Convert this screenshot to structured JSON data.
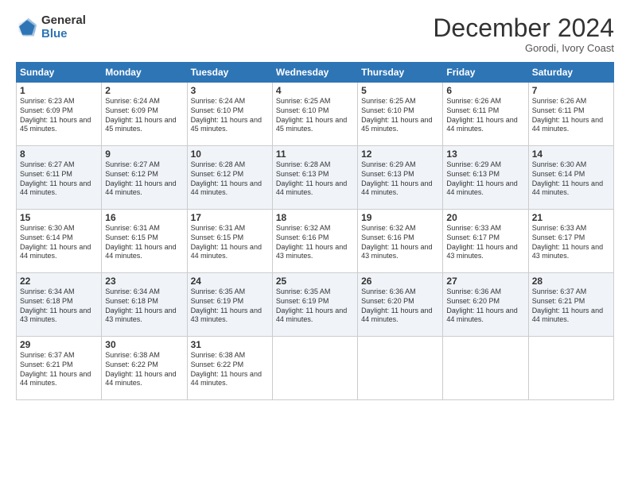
{
  "header": {
    "logo_general": "General",
    "logo_blue": "Blue",
    "month_title": "December 2024",
    "location": "Gorodi, Ivory Coast"
  },
  "days_of_week": [
    "Sunday",
    "Monday",
    "Tuesday",
    "Wednesday",
    "Thursday",
    "Friday",
    "Saturday"
  ],
  "weeks": [
    [
      {
        "day": "1",
        "sunrise": "6:23 AM",
        "sunset": "6:09 PM",
        "daylight": "11 hours and 45 minutes."
      },
      {
        "day": "2",
        "sunrise": "6:24 AM",
        "sunset": "6:09 PM",
        "daylight": "11 hours and 45 minutes."
      },
      {
        "day": "3",
        "sunrise": "6:24 AM",
        "sunset": "6:10 PM",
        "daylight": "11 hours and 45 minutes."
      },
      {
        "day": "4",
        "sunrise": "6:25 AM",
        "sunset": "6:10 PM",
        "daylight": "11 hours and 45 minutes."
      },
      {
        "day": "5",
        "sunrise": "6:25 AM",
        "sunset": "6:10 PM",
        "daylight": "11 hours and 45 minutes."
      },
      {
        "day": "6",
        "sunrise": "6:26 AM",
        "sunset": "6:11 PM",
        "daylight": "11 hours and 44 minutes."
      },
      {
        "day": "7",
        "sunrise": "6:26 AM",
        "sunset": "6:11 PM",
        "daylight": "11 hours and 44 minutes."
      }
    ],
    [
      {
        "day": "8",
        "sunrise": "6:27 AM",
        "sunset": "6:11 PM",
        "daylight": "11 hours and 44 minutes."
      },
      {
        "day": "9",
        "sunrise": "6:27 AM",
        "sunset": "6:12 PM",
        "daylight": "11 hours and 44 minutes."
      },
      {
        "day": "10",
        "sunrise": "6:28 AM",
        "sunset": "6:12 PM",
        "daylight": "11 hours and 44 minutes."
      },
      {
        "day": "11",
        "sunrise": "6:28 AM",
        "sunset": "6:13 PM",
        "daylight": "11 hours and 44 minutes."
      },
      {
        "day": "12",
        "sunrise": "6:29 AM",
        "sunset": "6:13 PM",
        "daylight": "11 hours and 44 minutes."
      },
      {
        "day": "13",
        "sunrise": "6:29 AM",
        "sunset": "6:13 PM",
        "daylight": "11 hours and 44 minutes."
      },
      {
        "day": "14",
        "sunrise": "6:30 AM",
        "sunset": "6:14 PM",
        "daylight": "11 hours and 44 minutes."
      }
    ],
    [
      {
        "day": "15",
        "sunrise": "6:30 AM",
        "sunset": "6:14 PM",
        "daylight": "11 hours and 44 minutes."
      },
      {
        "day": "16",
        "sunrise": "6:31 AM",
        "sunset": "6:15 PM",
        "daylight": "11 hours and 44 minutes."
      },
      {
        "day": "17",
        "sunrise": "6:31 AM",
        "sunset": "6:15 PM",
        "daylight": "11 hours and 44 minutes."
      },
      {
        "day": "18",
        "sunrise": "6:32 AM",
        "sunset": "6:16 PM",
        "daylight": "11 hours and 43 minutes."
      },
      {
        "day": "19",
        "sunrise": "6:32 AM",
        "sunset": "6:16 PM",
        "daylight": "11 hours and 43 minutes."
      },
      {
        "day": "20",
        "sunrise": "6:33 AM",
        "sunset": "6:17 PM",
        "daylight": "11 hours and 43 minutes."
      },
      {
        "day": "21",
        "sunrise": "6:33 AM",
        "sunset": "6:17 PM",
        "daylight": "11 hours and 43 minutes."
      }
    ],
    [
      {
        "day": "22",
        "sunrise": "6:34 AM",
        "sunset": "6:18 PM",
        "daylight": "11 hours and 43 minutes."
      },
      {
        "day": "23",
        "sunrise": "6:34 AM",
        "sunset": "6:18 PM",
        "daylight": "11 hours and 43 minutes."
      },
      {
        "day": "24",
        "sunrise": "6:35 AM",
        "sunset": "6:19 PM",
        "daylight": "11 hours and 43 minutes."
      },
      {
        "day": "25",
        "sunrise": "6:35 AM",
        "sunset": "6:19 PM",
        "daylight": "11 hours and 44 minutes."
      },
      {
        "day": "26",
        "sunrise": "6:36 AM",
        "sunset": "6:20 PM",
        "daylight": "11 hours and 44 minutes."
      },
      {
        "day": "27",
        "sunrise": "6:36 AM",
        "sunset": "6:20 PM",
        "daylight": "11 hours and 44 minutes."
      },
      {
        "day": "28",
        "sunrise": "6:37 AM",
        "sunset": "6:21 PM",
        "daylight": "11 hours and 44 minutes."
      }
    ],
    [
      {
        "day": "29",
        "sunrise": "6:37 AM",
        "sunset": "6:21 PM",
        "daylight": "11 hours and 44 minutes."
      },
      {
        "day": "30",
        "sunrise": "6:38 AM",
        "sunset": "6:22 PM",
        "daylight": "11 hours and 44 minutes."
      },
      {
        "day": "31",
        "sunrise": "6:38 AM",
        "sunset": "6:22 PM",
        "daylight": "11 hours and 44 minutes."
      },
      null,
      null,
      null,
      null
    ]
  ]
}
